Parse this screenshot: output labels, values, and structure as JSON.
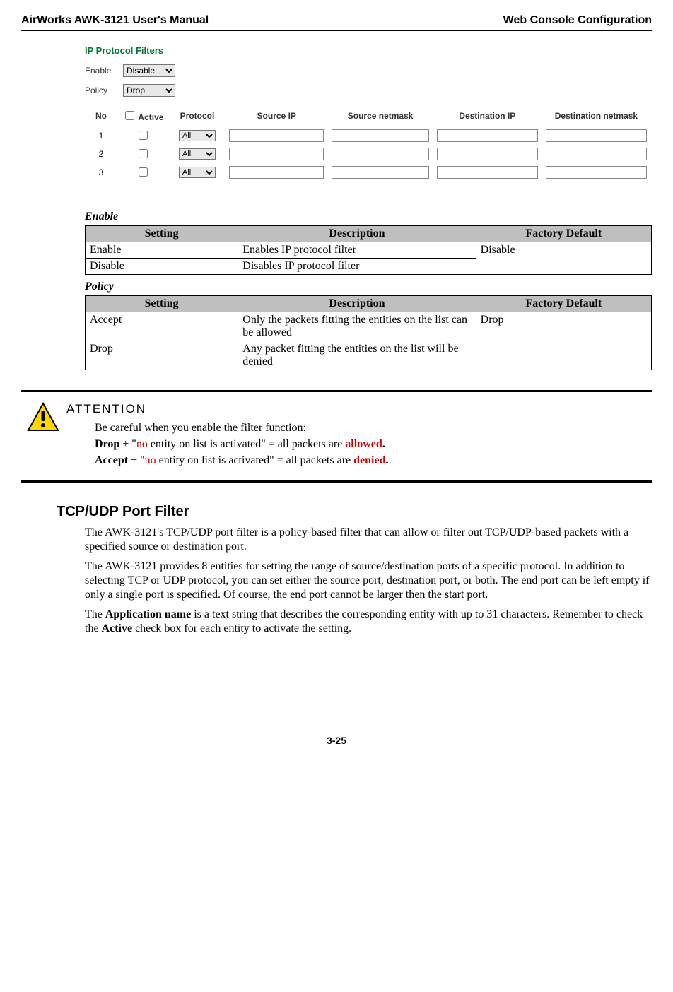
{
  "header": {
    "left": "AirWorks AWK-3121 User's Manual",
    "right": "Web Console Configuration"
  },
  "panel": {
    "title": "IP Protocol Filters",
    "enable_label": "Enable",
    "enable_value": "Disable",
    "policy_label": "Policy",
    "policy_value": "Drop",
    "cols": {
      "no": "No",
      "active": " Active",
      "protocol": "Protocol",
      "src_ip": "Source IP",
      "src_nm": "Source netmask",
      "dst_ip": "Destination IP",
      "dst_nm": "Destination netmask"
    },
    "rows": [
      {
        "no": "1",
        "proto": "All"
      },
      {
        "no": "2",
        "proto": "All"
      },
      {
        "no": "3",
        "proto": "All"
      }
    ]
  },
  "enable_section": {
    "heading": "Enable",
    "cols": {
      "s": "Setting",
      "d": "Description",
      "f": "Factory Default"
    },
    "r1s": "Enable",
    "r1d": "Enables IP protocol filter",
    "r2s": "Disable",
    "r2d": "Disables IP protocol filter",
    "default": "Disable"
  },
  "policy_section": {
    "heading": "Policy",
    "cols": {
      "s": "Setting",
      "d": "Description",
      "f": "Factory Default"
    },
    "r1s": "Accept",
    "r1d": "Only the packets fitting the entities on the list can be allowed",
    "r2s": "Drop",
    "r2d": "Any packet fitting the entities on the list will be denied",
    "default": "Drop"
  },
  "attention": {
    "title": "ATTENTION",
    "line1": "Be careful when you enable the filter function:",
    "line2a": "Drop",
    "line2b": " + \"",
    "line2c": "no",
    "line2d": " entity on list is activated\" = all packets are ",
    "line2e": "allowed",
    "line2f": ".",
    "line3a": "Accept",
    "line3b": " + \"",
    "line3c": "no",
    "line3d": " entity on list is activated\" = all packets are ",
    "line3e": "denied",
    "line3f": "."
  },
  "tcpudp": {
    "heading": "TCP/UDP Port Filter",
    "p1": "The AWK-3121's TCP/UDP port filter is a policy-based filter that can allow or filter out TCP/UDP-based packets with a specified source or destination port.",
    "p2": "The AWK-3121 provides 8 entities for setting the range of source/destination ports of a specific protocol. In addition to selecting TCP or UDP protocol, you can set either the source port, destination port, or both. The end port can be left empty if only a single port is specified. Of course, the end port cannot be larger then the start port.",
    "p3a": "The ",
    "p3b": "Application name",
    "p3c": " is a text string that describes the corresponding entity with up to 31 characters. Remember to check the ",
    "p3d": "Active",
    "p3e": " check box for each entity to activate the setting."
  },
  "page_num": "3-25"
}
